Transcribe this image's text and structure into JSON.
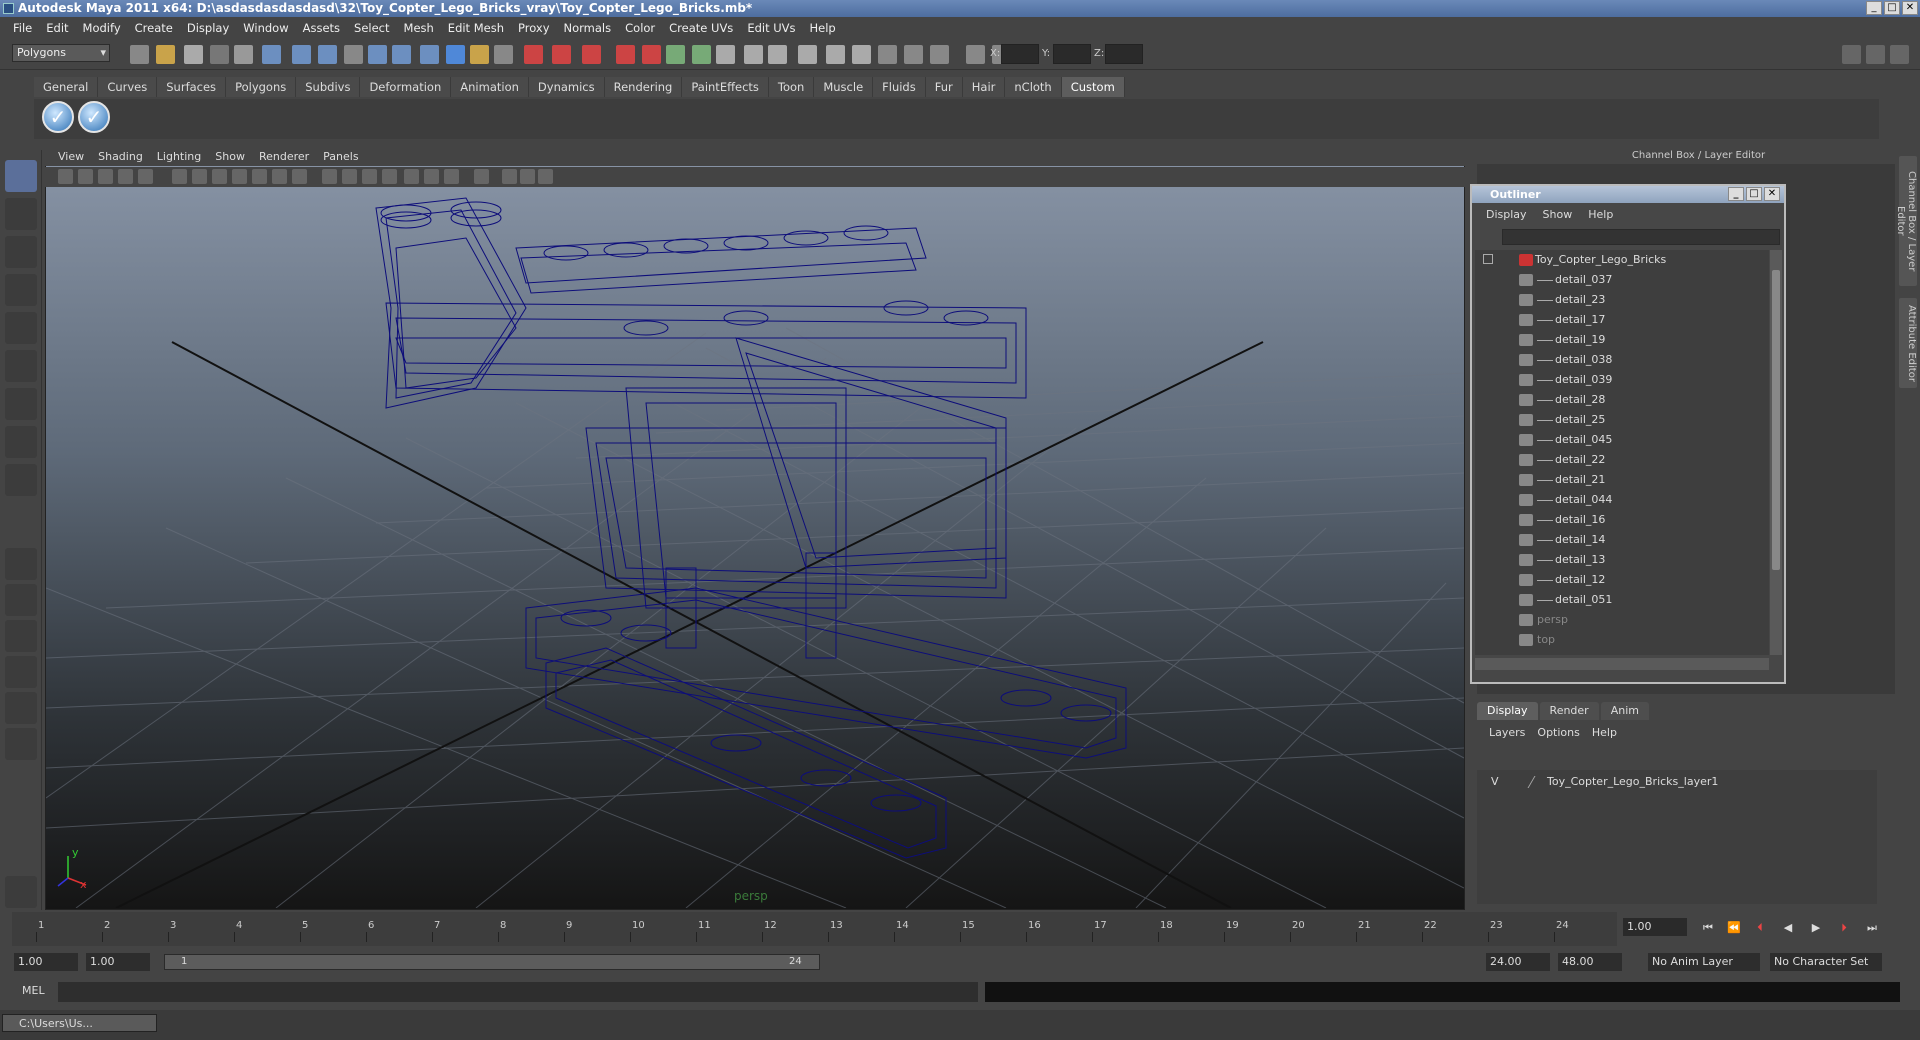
{
  "window": {
    "title": "Autodesk Maya 2011 x64: D:\\asdasdasdasdasd\\32\\Toy_Copter_Lego_Bricks_vray\\Toy_Copter_Lego_Bricks.mb*"
  },
  "menubar": [
    "File",
    "Edit",
    "Modify",
    "Create",
    "Display",
    "Window",
    "Assets",
    "Select",
    "Mesh",
    "Edit Mesh",
    "Proxy",
    "Normals",
    "Color",
    "Create UVs",
    "Edit UVs",
    "Help"
  ],
  "status": {
    "mode": "Polygons",
    "x_label": "X:",
    "y_label": "Y:",
    "z_label": "Z:"
  },
  "shelf": {
    "tabs": [
      "General",
      "Curves",
      "Surfaces",
      "Polygons",
      "Subdivs",
      "Deformation",
      "Animation",
      "Dynamics",
      "Rendering",
      "PaintEffects",
      "Toon",
      "Muscle",
      "Fluids",
      "Fur",
      "Hair",
      "nCloth",
      "Custom"
    ],
    "active": "Custom"
  },
  "viewport": {
    "menu": [
      "View",
      "Shading",
      "Lighting",
      "Show",
      "Renderer",
      "Panels"
    ],
    "camera_label": "persp",
    "axis_x": "x",
    "axis_y": "y"
  },
  "channel_box": {
    "label": "Channel Box / Layer Editor",
    "side_tabs": [
      "Channel Box / Layer Editor",
      "Attribute Editor"
    ]
  },
  "outliner": {
    "title": "Outliner",
    "menu": [
      "Display",
      "Show",
      "Help"
    ],
    "root": "Toy_Copter_Lego_Bricks",
    "items": [
      "detail_037",
      "detail_23",
      "detail_17",
      "detail_19",
      "detail_038",
      "detail_039",
      "detail_28",
      "detail_25",
      "detail_045",
      "detail_22",
      "detail_21",
      "detail_044",
      "detail_16",
      "detail_14",
      "detail_13",
      "detail_12",
      "detail_051"
    ],
    "cameras": [
      "persp",
      "top"
    ]
  },
  "layers": {
    "tabs": [
      "Display",
      "Render",
      "Anim"
    ],
    "active": "Display",
    "menu": [
      "Layers",
      "Options",
      "Help"
    ],
    "row": {
      "visible": "V",
      "name": "Toy_Copter_Lego_Bricks_layer1"
    }
  },
  "timeline": {
    "ticks": [
      "1",
      "2",
      "3",
      "4",
      "5",
      "6",
      "7",
      "8",
      "9",
      "10",
      "11",
      "12",
      "13",
      "14",
      "15",
      "16",
      "17",
      "18",
      "19",
      "20",
      "21",
      "22",
      "23",
      "24"
    ],
    "current_time": "1.00"
  },
  "range": {
    "start": "1.00",
    "playback_start": "1.00",
    "slider_start": "1",
    "slider_end": "24",
    "playback_end": "24.00",
    "end": "48.00",
    "anim_layer": "No Anim Layer",
    "char_set": "No Character Set"
  },
  "command": {
    "label": "MEL"
  },
  "taskbar": {
    "item": "C:\\Users\\Us..."
  }
}
